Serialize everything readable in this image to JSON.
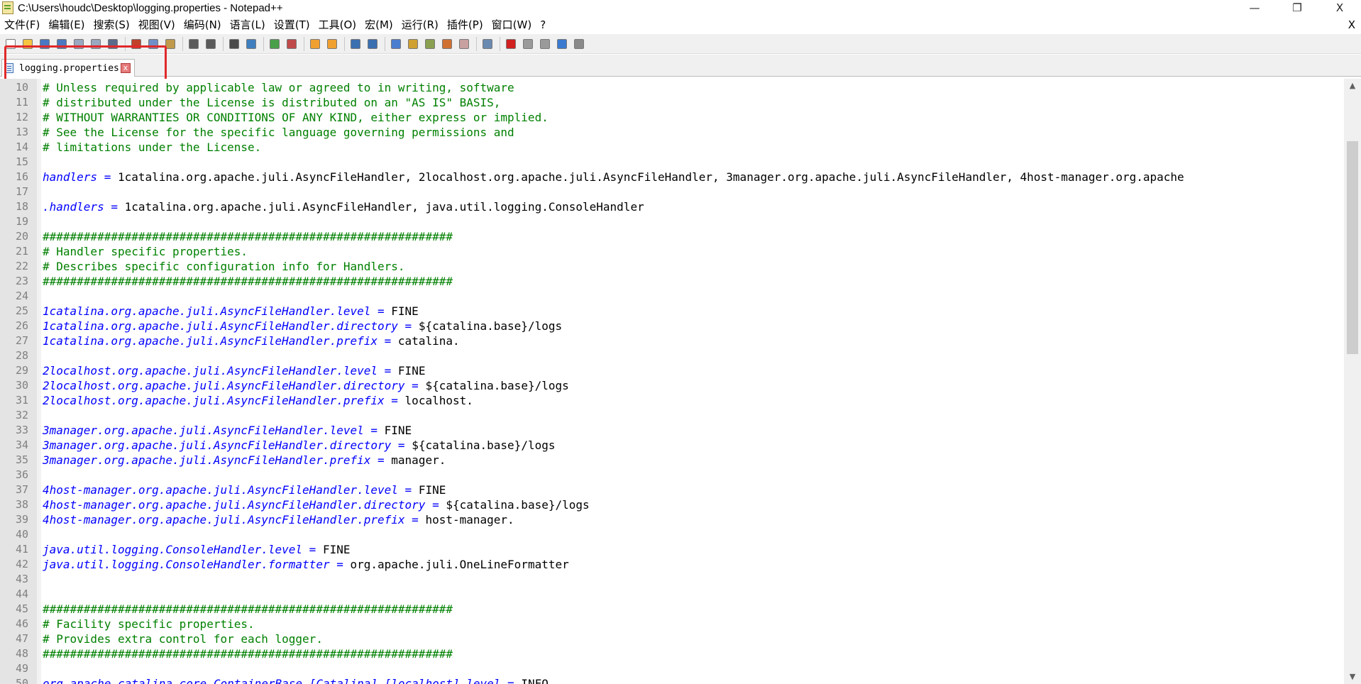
{
  "window": {
    "title": "C:\\Users\\houdc\\Desktop\\logging.properties - Notepad++",
    "minimize": "—",
    "restore": "❐",
    "close": "X"
  },
  "menu": {
    "items": [
      "文件(F)",
      "编辑(E)",
      "搜索(S)",
      "视图(V)",
      "编码(N)",
      "语言(L)",
      "设置(T)",
      "工具(O)",
      "宏(M)",
      "运行(R)",
      "插件(P)",
      "窗口(W)",
      "?"
    ],
    "close_doc": "X"
  },
  "toolbar": {
    "icons": [
      "new-file-icon",
      "open-file-icon",
      "save-icon",
      "save-all-icon",
      "close-icon",
      "close-all-icon",
      "print-icon",
      "cut-icon",
      "copy-icon",
      "paste-icon",
      "undo-icon",
      "redo-icon",
      "find-icon",
      "replace-icon",
      "zoom-in-icon",
      "zoom-out-icon",
      "sync-vertical-icon",
      "sync-horizontal-icon",
      "word-wrap-icon",
      "show-all-chars-icon",
      "indent-guide-icon",
      "language-icon",
      "doc-map-icon",
      "function-list-icon",
      "folder-workspace-icon",
      "monitor-icon",
      "record-macro-icon",
      "stop-record-icon",
      "play-macro-icon",
      "run-macro-multiple-icon",
      "save-macro-icon"
    ]
  },
  "tabs": [
    {
      "label": "logging.properties",
      "close": "x",
      "active": true
    }
  ],
  "editor": {
    "lines": [
      {
        "n": "10",
        "tokens": [
          {
            "t": "# Unless required by applicable law or agreed to in writing, software",
            "c": "comment"
          }
        ]
      },
      {
        "n": "11",
        "tokens": [
          {
            "t": "# distributed under the License is distributed on an \"AS IS\" BASIS,",
            "c": "comment"
          }
        ]
      },
      {
        "n": "12",
        "tokens": [
          {
            "t": "# WITHOUT WARRANTIES OR CONDITIONS OF ANY KIND, either express or implied.",
            "c": "comment"
          }
        ]
      },
      {
        "n": "13",
        "tokens": [
          {
            "t": "# See the License for the specific language governing permissions and",
            "c": "comment"
          }
        ]
      },
      {
        "n": "14",
        "tokens": [
          {
            "t": "# limitations under the License.",
            "c": "comment"
          }
        ]
      },
      {
        "n": "15",
        "tokens": []
      },
      {
        "n": "16",
        "tokens": [
          {
            "t": "handlers",
            "c": "key"
          },
          {
            "t": " = ",
            "c": "op"
          },
          {
            "t": "1catalina.org.apache.juli.AsyncFileHandler, 2localhost.org.apache.juli.AsyncFileHandler, 3manager.org.apache.juli.AsyncFileHandler, 4host-manager.org.apache",
            "c": "val"
          }
        ]
      },
      {
        "n": "17",
        "tokens": []
      },
      {
        "n": "18",
        "tokens": [
          {
            "t": ".handlers",
            "c": "key"
          },
          {
            "t": " = ",
            "c": "op"
          },
          {
            "t": "1catalina.org.apache.juli.AsyncFileHandler, java.util.logging.ConsoleHandler",
            "c": "val"
          }
        ]
      },
      {
        "n": "19",
        "tokens": []
      },
      {
        "n": "20",
        "tokens": [
          {
            "t": "############################################################",
            "c": "comment"
          }
        ]
      },
      {
        "n": "21",
        "tokens": [
          {
            "t": "# Handler specific properties.",
            "c": "comment"
          }
        ]
      },
      {
        "n": "22",
        "tokens": [
          {
            "t": "# Describes specific configuration info for Handlers.",
            "c": "comment"
          }
        ]
      },
      {
        "n": "23",
        "tokens": [
          {
            "t": "############################################################",
            "c": "comment"
          }
        ]
      },
      {
        "n": "24",
        "tokens": []
      },
      {
        "n": "25",
        "tokens": [
          {
            "t": "1catalina.org.apache.juli.AsyncFileHandler.level",
            "c": "key"
          },
          {
            "t": " = ",
            "c": "op"
          },
          {
            "t": "FINE",
            "c": "val"
          }
        ]
      },
      {
        "n": "26",
        "tokens": [
          {
            "t": "1catalina.org.apache.juli.AsyncFileHandler.directory",
            "c": "key"
          },
          {
            "t": " = ",
            "c": "op"
          },
          {
            "t": "${catalina.base}/logs",
            "c": "val"
          }
        ]
      },
      {
        "n": "27",
        "tokens": [
          {
            "t": "1catalina.org.apache.juli.AsyncFileHandler.prefix",
            "c": "key"
          },
          {
            "t": " = ",
            "c": "op"
          },
          {
            "t": "catalina.",
            "c": "val"
          }
        ]
      },
      {
        "n": "28",
        "tokens": []
      },
      {
        "n": "29",
        "tokens": [
          {
            "t": "2localhost.org.apache.juli.AsyncFileHandler.level",
            "c": "key"
          },
          {
            "t": " = ",
            "c": "op"
          },
          {
            "t": "FINE",
            "c": "val"
          }
        ]
      },
      {
        "n": "30",
        "tokens": [
          {
            "t": "2localhost.org.apache.juli.AsyncFileHandler.directory",
            "c": "key"
          },
          {
            "t": " = ",
            "c": "op"
          },
          {
            "t": "${catalina.base}/logs",
            "c": "val"
          }
        ]
      },
      {
        "n": "31",
        "tokens": [
          {
            "t": "2localhost.org.apache.juli.AsyncFileHandler.prefix",
            "c": "key"
          },
          {
            "t": " = ",
            "c": "op"
          },
          {
            "t": "localhost.",
            "c": "val"
          }
        ]
      },
      {
        "n": "32",
        "tokens": []
      },
      {
        "n": "33",
        "tokens": [
          {
            "t": "3manager.org.apache.juli.AsyncFileHandler.level",
            "c": "key"
          },
          {
            "t": " = ",
            "c": "op"
          },
          {
            "t": "FINE",
            "c": "val"
          }
        ]
      },
      {
        "n": "34",
        "tokens": [
          {
            "t": "3manager.org.apache.juli.AsyncFileHandler.directory",
            "c": "key"
          },
          {
            "t": " = ",
            "c": "op"
          },
          {
            "t": "${catalina.base}/logs",
            "c": "val"
          }
        ]
      },
      {
        "n": "35",
        "tokens": [
          {
            "t": "3manager.org.apache.juli.AsyncFileHandler.prefix",
            "c": "key"
          },
          {
            "t": " = ",
            "c": "op"
          },
          {
            "t": "manager.",
            "c": "val"
          }
        ]
      },
      {
        "n": "36",
        "tokens": []
      },
      {
        "n": "37",
        "tokens": [
          {
            "t": "4host-manager.org.apache.juli.AsyncFileHandler.level",
            "c": "key"
          },
          {
            "t": " = ",
            "c": "op"
          },
          {
            "t": "FINE",
            "c": "val"
          }
        ]
      },
      {
        "n": "38",
        "tokens": [
          {
            "t": "4host-manager.org.apache.juli.AsyncFileHandler.directory",
            "c": "key"
          },
          {
            "t": " = ",
            "c": "op"
          },
          {
            "t": "${catalina.base}/logs",
            "c": "val"
          }
        ]
      },
      {
        "n": "39",
        "tokens": [
          {
            "t": "4host-manager.org.apache.juli.AsyncFileHandler.prefix",
            "c": "key"
          },
          {
            "t": " = ",
            "c": "op"
          },
          {
            "t": "host-manager.",
            "c": "val"
          }
        ]
      },
      {
        "n": "40",
        "tokens": []
      },
      {
        "n": "41",
        "tokens": [
          {
            "t": "java.util.logging.ConsoleHandler.level",
            "c": "key"
          },
          {
            "t": " = ",
            "c": "op"
          },
          {
            "t": "FINE",
            "c": "val"
          }
        ]
      },
      {
        "n": "42",
        "tokens": [
          {
            "t": "java.util.logging.ConsoleHandler.formatter",
            "c": "key"
          },
          {
            "t": " = ",
            "c": "op"
          },
          {
            "t": "org.apache.juli.OneLineFormatter",
            "c": "val"
          }
        ]
      },
      {
        "n": "43",
        "tokens": []
      },
      {
        "n": "44",
        "tokens": []
      },
      {
        "n": "45",
        "tokens": [
          {
            "t": "############################################################",
            "c": "comment"
          }
        ]
      },
      {
        "n": "46",
        "tokens": [
          {
            "t": "# Facility specific properties.",
            "c": "comment"
          }
        ]
      },
      {
        "n": "47",
        "tokens": [
          {
            "t": "# Provides extra control for each logger.",
            "c": "comment"
          }
        ]
      },
      {
        "n": "48",
        "tokens": [
          {
            "t": "############################################################",
            "c": "comment"
          }
        ]
      },
      {
        "n": "49",
        "tokens": []
      },
      {
        "n": "50",
        "tokens": [
          {
            "t": "org.apache.catalina.core.ContainerBase.[Catalina].[localhost].level",
            "c": "key"
          },
          {
            "t": " = ",
            "c": "op"
          },
          {
            "t": "INFO",
            "c": "val"
          }
        ]
      }
    ]
  },
  "scrollbar": {
    "up": "▲",
    "down": "▼"
  },
  "colors": {
    "comment": "#008000",
    "key": "#0000ff",
    "highlight": "#e0292b"
  }
}
